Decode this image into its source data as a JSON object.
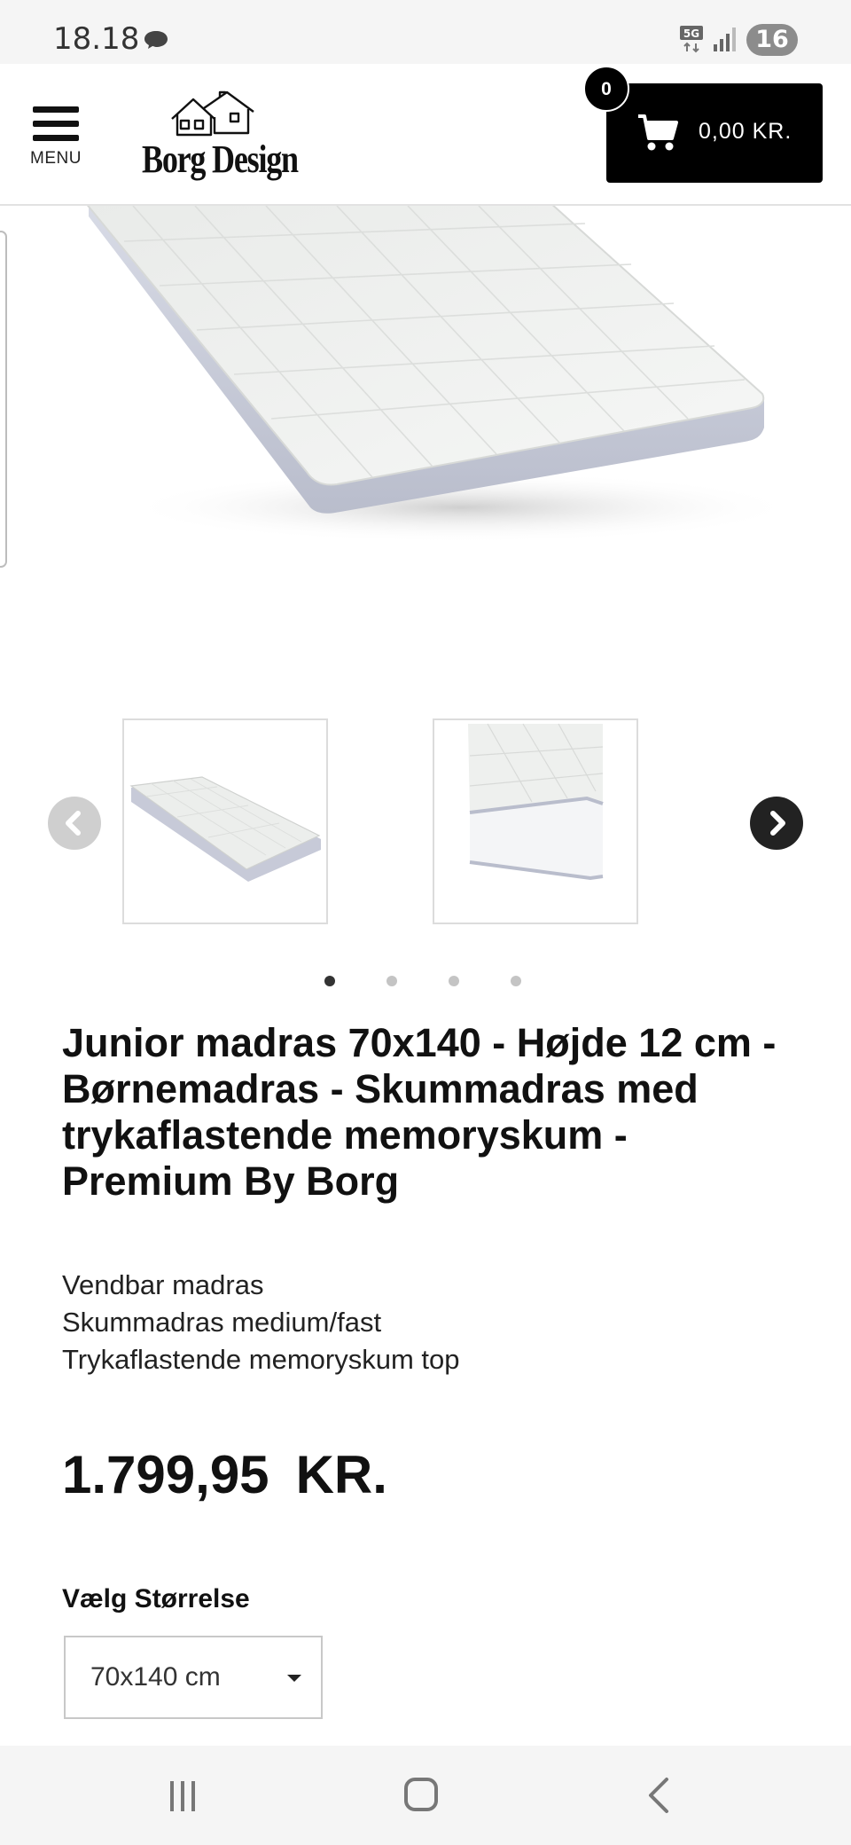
{
  "status_bar": {
    "time": "18.18",
    "network": "5G",
    "battery": "16",
    "icons": [
      "chat-bubble-icon",
      "5g-icon",
      "signal-icon",
      "battery-icon"
    ]
  },
  "header": {
    "menu_label": "MENU",
    "logo_text": "Borg Design",
    "cart_count": "0",
    "cart_total": "0,00 KR."
  },
  "gallery": {
    "slide_count": 4,
    "active_slide": 1,
    "thumbnails": [
      "mattress-full-view",
      "mattress-corner-closeup"
    ]
  },
  "product": {
    "title": "Junior madras 70x140 - Højde 12 cm - Børnemadras - Skummadras med trykaflastende memoryskum - Premium By Borg",
    "features": [
      "Vendbar madras",
      "Skummadras medium/fast",
      "Trykaflastende memoryskum top"
    ],
    "price_amount": "1.799,95",
    "price_currency": "KR.",
    "size_label": "Vælg Størrelse",
    "size_selected": "70x140 cm"
  },
  "colors": {
    "accent": "#000000",
    "background": "#ffffff",
    "system_bar": "#f5f5f5"
  }
}
